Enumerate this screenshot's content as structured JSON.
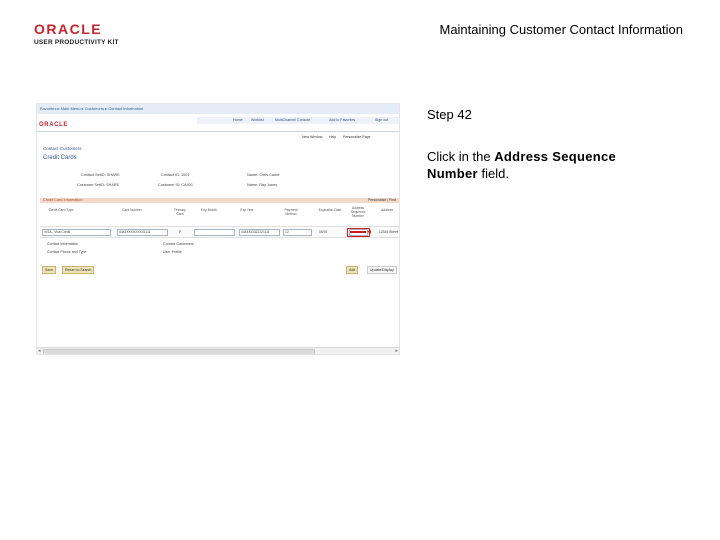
{
  "header": {
    "logo_word": "ORACLE",
    "logo_sub": "USER PRODUCTIVITY KIT",
    "title": "Maintaining Customer Contact Information"
  },
  "step": {
    "label": "Step 42"
  },
  "instruction": {
    "prefix": "Click in the ",
    "bold": "Address Sequence Number",
    "suffix": " field."
  },
  "screenshot": {
    "breadcrumb": "Favorites  ▸  Main Menu  ▸  Customers  ▸  Contact Information",
    "logo": "ORACLE",
    "nav": [
      "Home",
      "Worklist",
      "MultiChannel Console",
      "Add to Favorites",
      "Sign out"
    ],
    "toolbar": [
      "New Window",
      "Help",
      "Personalize Page"
    ],
    "page_title": "Contact Customers",
    "page_subtitle": "Credit Cards",
    "labels": [
      "Contact SetID: SHARE",
      "Contact ID: 1001",
      "Name: Chris Carter",
      "Customer SetID: SHARE",
      "Customer ID: CA001",
      "Name: Ray Jones"
    ],
    "grid_title": "Credit Card Information",
    "grid_right": "Personalize | Find",
    "columns": [
      "Credit Card Type",
      "Card Number",
      "Primary Card",
      "Exp Month",
      "Exp Year",
      "Payment Method",
      "Expiration Date",
      "Address Sequence Number",
      "Address"
    ],
    "row": [
      "VISA - Visa Credit",
      "4444XXXXXXXX1111",
      "P",
      "",
      "4444333322221111",
      "12",
      "05/76",
      "",
      "12345 Street"
    ],
    "links": [
      "Contact Information",
      "Contact Customers",
      "Contact Phone and Type",
      "User Profile"
    ],
    "buttons": [
      "Save",
      "Return to Search",
      "Add",
      "Update/Display"
    ]
  }
}
